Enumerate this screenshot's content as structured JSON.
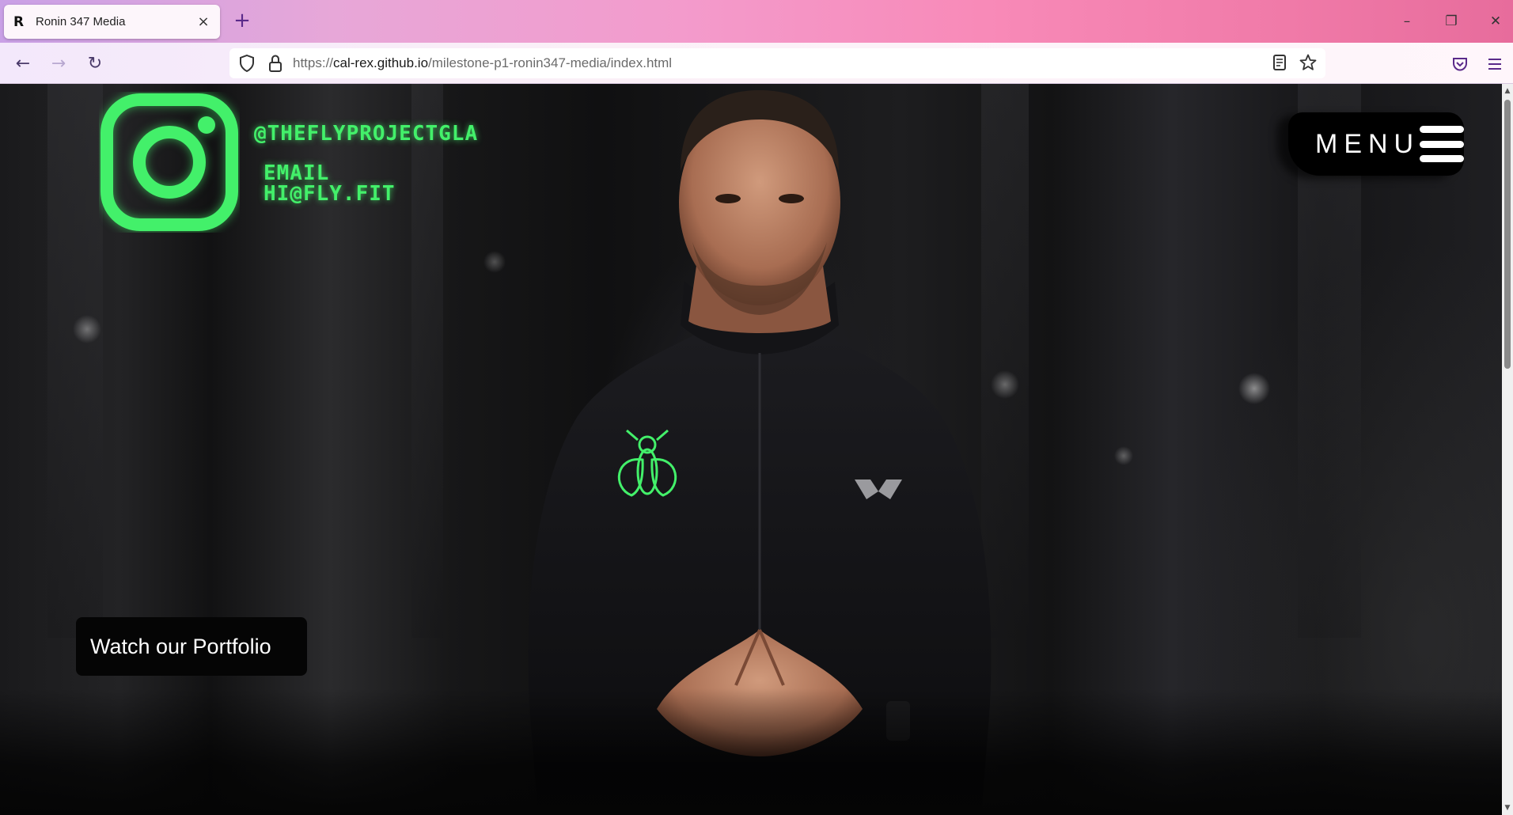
{
  "browser": {
    "tab": {
      "title": "Ronin 347 Media",
      "favicon": "R",
      "close_icon": "×"
    },
    "new_tab_icon": "+",
    "window": {
      "minimize": "–",
      "restore": "❐",
      "close": "✕"
    },
    "nav": {
      "back": "←",
      "forward": "→",
      "reload": "↻"
    },
    "url": {
      "scheme": "https://",
      "host": "cal-rex.github.io",
      "path": "/milestone-p1-ronin347-media/index.html"
    },
    "icons": [
      "shield-icon",
      "lock-icon",
      "reader-view-icon",
      "bookmark-star-icon",
      "pocket-icon",
      "hamburger-menu-icon"
    ]
  },
  "page": {
    "social": {
      "instagram_handle": "@THEFLYPROJECTGLA",
      "email_label": "EMAIL",
      "email_value": "HI@FLY.FIT"
    },
    "menu_label": "MENU",
    "portfolio_label": "Watch our Portfolio",
    "colors": {
      "accent_green": "#43f06a",
      "background": "#000000",
      "button_text": "#ffffff"
    }
  }
}
